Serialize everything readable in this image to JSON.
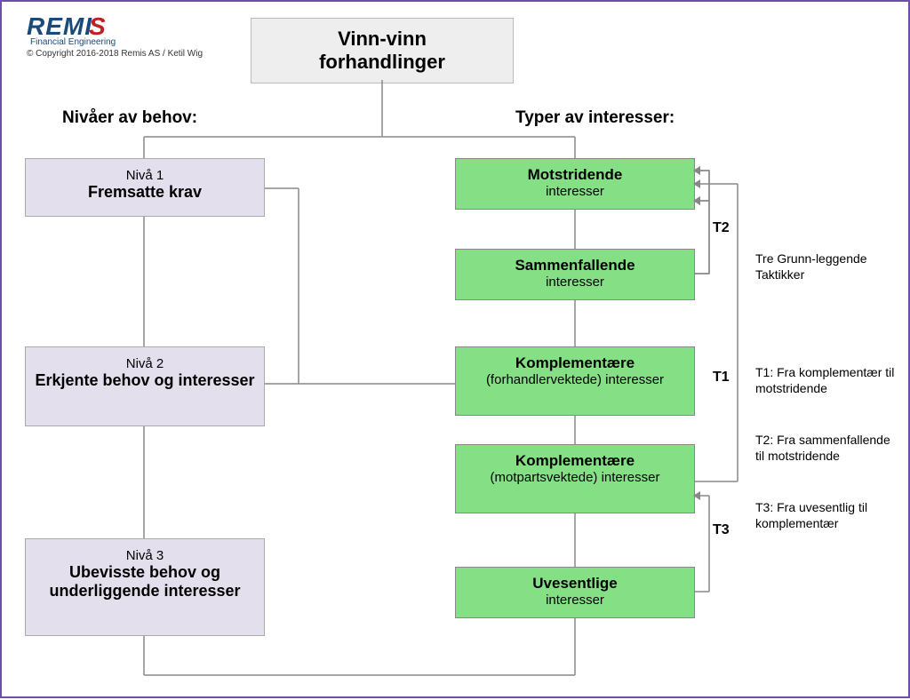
{
  "logo": {
    "name": "REMI",
    "swoosh": "S",
    "subtitle": "Financial Engineering"
  },
  "copyright": "Copyright  2016-2018 Remis AS / Ketil Wig",
  "title": {
    "line1": "Vinn-vinn",
    "line2": "forhandlinger"
  },
  "headings": {
    "left": "Nivåer av behov:",
    "right": "Typer av interesser:"
  },
  "levels": [
    {
      "label": "Nivå 1",
      "title": "Fremsatte krav"
    },
    {
      "label": "Nivå 2",
      "title": "Erkjente behov og interesser"
    },
    {
      "label": "Nivå 3",
      "title": "Ubevisste behov og underliggende interesser"
    }
  ],
  "interests": [
    {
      "title": "Motstridende",
      "sub": "interesser"
    },
    {
      "title": "Sammenfallende",
      "sub": "interesser"
    },
    {
      "title": "Komplementære",
      "sub": "(forhandlervektede) interesser"
    },
    {
      "title": "Komplementære",
      "sub": "(motpartsvektede) interesser"
    },
    {
      "title": "Uvesentlige",
      "sub": "interesser"
    }
  ],
  "tactics": {
    "t1": "T1",
    "t2": "T2",
    "t3": "T3",
    "heading": "Tre Grunn-leggende Taktikker",
    "desc_t1": "T1: Fra komplementær til motstridende",
    "desc_t2": "T2: Fra sammenfallende til motstridende",
    "desc_t3": "T3: Fra uvesentlig til komplementær"
  }
}
